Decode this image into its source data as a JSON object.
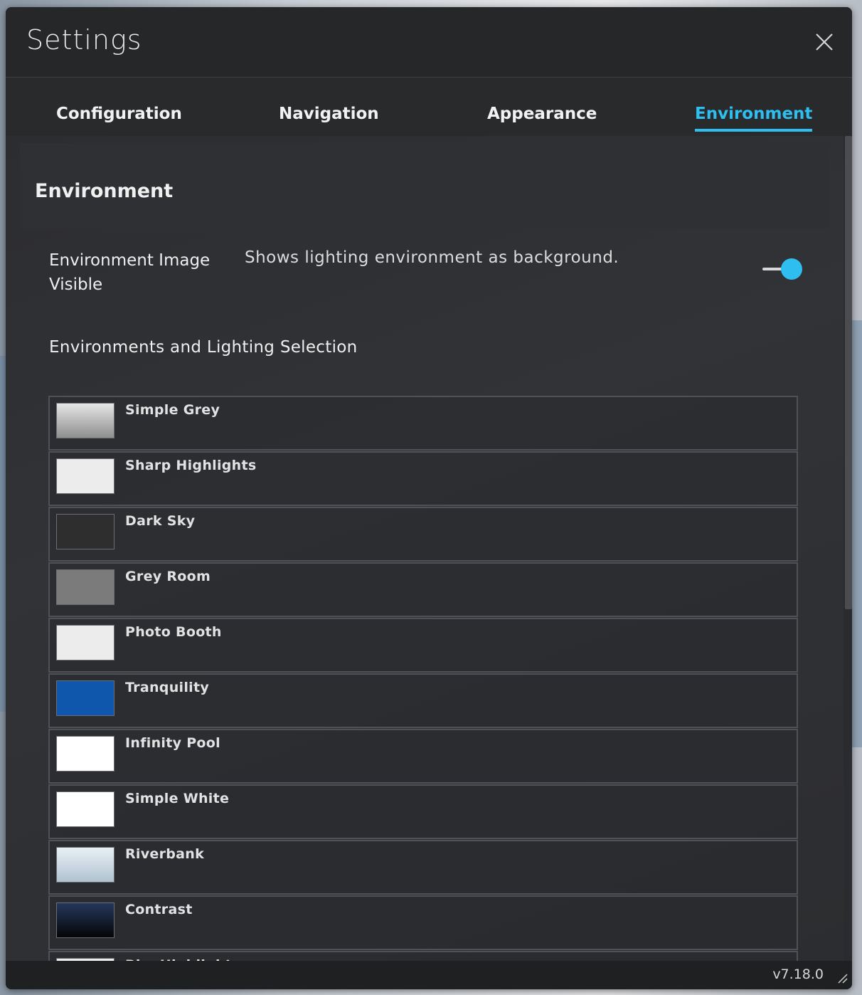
{
  "window": {
    "title": "Settings",
    "version": "v7.18.0"
  },
  "tabs": [
    {
      "label": "Configuration",
      "active": false
    },
    {
      "label": "Navigation",
      "active": false
    },
    {
      "label": "Appearance",
      "active": false
    },
    {
      "label": "Environment",
      "active": true
    }
  ],
  "section": {
    "title": "Environment"
  },
  "setting": {
    "label": "Environment Image Visible",
    "description": "Shows lighting environment as background.",
    "enabled": true
  },
  "list": {
    "title": "Environments and Lighting Selection",
    "items": [
      {
        "label": "Simple Grey",
        "swatch": "linear-gradient(#e6e6e6,#8e8e8e)"
      },
      {
        "label": "Sharp Highlights",
        "swatch": "#ececec"
      },
      {
        "label": "Dark Sky",
        "swatch": "#2e2e2e"
      },
      {
        "label": "Grey Room",
        "swatch": "#7b7b7b"
      },
      {
        "label": "Photo Booth",
        "swatch": "#ececec"
      },
      {
        "label": "Tranquility",
        "swatch": "#0e57ad"
      },
      {
        "label": "Infinity Pool",
        "swatch": "#ffffff"
      },
      {
        "label": "Simple White",
        "swatch": "#ffffff"
      },
      {
        "label": "Riverbank",
        "swatch": "linear-gradient(#e8f0f6,#b0c2d0)"
      },
      {
        "label": "Contrast",
        "swatch": "linear-gradient(#24385c,#050505)"
      },
      {
        "label": "Rim Highlights",
        "swatch": "#ececec"
      }
    ]
  },
  "colors": {
    "accent": "#2fbef0",
    "panel": "#2b2c2e"
  },
  "icons": {
    "close": "close-icon",
    "resize": "resize-grip-icon"
  }
}
